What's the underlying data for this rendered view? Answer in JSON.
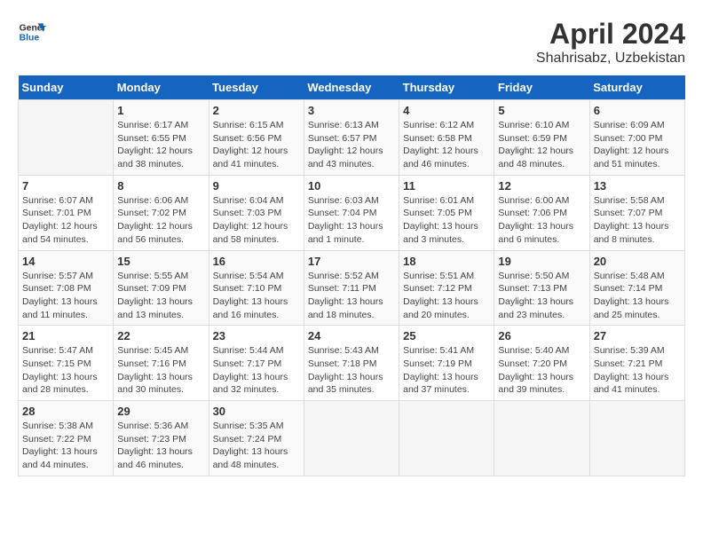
{
  "header": {
    "logo_line1": "General",
    "logo_line2": "Blue",
    "title": "April 2024",
    "subtitle": "Shahrisabz, Uzbekistan"
  },
  "calendar": {
    "days_of_week": [
      "Sunday",
      "Monday",
      "Tuesday",
      "Wednesday",
      "Thursday",
      "Friday",
      "Saturday"
    ],
    "weeks": [
      [
        {
          "num": "",
          "detail": ""
        },
        {
          "num": "1",
          "detail": "Sunrise: 6:17 AM\nSunset: 6:55 PM\nDaylight: 12 hours\nand 38 minutes."
        },
        {
          "num": "2",
          "detail": "Sunrise: 6:15 AM\nSunset: 6:56 PM\nDaylight: 12 hours\nand 41 minutes."
        },
        {
          "num": "3",
          "detail": "Sunrise: 6:13 AM\nSunset: 6:57 PM\nDaylight: 12 hours\nand 43 minutes."
        },
        {
          "num": "4",
          "detail": "Sunrise: 6:12 AM\nSunset: 6:58 PM\nDaylight: 12 hours\nand 46 minutes."
        },
        {
          "num": "5",
          "detail": "Sunrise: 6:10 AM\nSunset: 6:59 PM\nDaylight: 12 hours\nand 48 minutes."
        },
        {
          "num": "6",
          "detail": "Sunrise: 6:09 AM\nSunset: 7:00 PM\nDaylight: 12 hours\nand 51 minutes."
        }
      ],
      [
        {
          "num": "7",
          "detail": "Sunrise: 6:07 AM\nSunset: 7:01 PM\nDaylight: 12 hours\nand 54 minutes."
        },
        {
          "num": "8",
          "detail": "Sunrise: 6:06 AM\nSunset: 7:02 PM\nDaylight: 12 hours\nand 56 minutes."
        },
        {
          "num": "9",
          "detail": "Sunrise: 6:04 AM\nSunset: 7:03 PM\nDaylight: 12 hours\nand 58 minutes."
        },
        {
          "num": "10",
          "detail": "Sunrise: 6:03 AM\nSunset: 7:04 PM\nDaylight: 13 hours\nand 1 minute."
        },
        {
          "num": "11",
          "detail": "Sunrise: 6:01 AM\nSunset: 7:05 PM\nDaylight: 13 hours\nand 3 minutes."
        },
        {
          "num": "12",
          "detail": "Sunrise: 6:00 AM\nSunset: 7:06 PM\nDaylight: 13 hours\nand 6 minutes."
        },
        {
          "num": "13",
          "detail": "Sunrise: 5:58 AM\nSunset: 7:07 PM\nDaylight: 13 hours\nand 8 minutes."
        }
      ],
      [
        {
          "num": "14",
          "detail": "Sunrise: 5:57 AM\nSunset: 7:08 PM\nDaylight: 13 hours\nand 11 minutes."
        },
        {
          "num": "15",
          "detail": "Sunrise: 5:55 AM\nSunset: 7:09 PM\nDaylight: 13 hours\nand 13 minutes."
        },
        {
          "num": "16",
          "detail": "Sunrise: 5:54 AM\nSunset: 7:10 PM\nDaylight: 13 hours\nand 16 minutes."
        },
        {
          "num": "17",
          "detail": "Sunrise: 5:52 AM\nSunset: 7:11 PM\nDaylight: 13 hours\nand 18 minutes."
        },
        {
          "num": "18",
          "detail": "Sunrise: 5:51 AM\nSunset: 7:12 PM\nDaylight: 13 hours\nand 20 minutes."
        },
        {
          "num": "19",
          "detail": "Sunrise: 5:50 AM\nSunset: 7:13 PM\nDaylight: 13 hours\nand 23 minutes."
        },
        {
          "num": "20",
          "detail": "Sunrise: 5:48 AM\nSunset: 7:14 PM\nDaylight: 13 hours\nand 25 minutes."
        }
      ],
      [
        {
          "num": "21",
          "detail": "Sunrise: 5:47 AM\nSunset: 7:15 PM\nDaylight: 13 hours\nand 28 minutes."
        },
        {
          "num": "22",
          "detail": "Sunrise: 5:45 AM\nSunset: 7:16 PM\nDaylight: 13 hours\nand 30 minutes."
        },
        {
          "num": "23",
          "detail": "Sunrise: 5:44 AM\nSunset: 7:17 PM\nDaylight: 13 hours\nand 32 minutes."
        },
        {
          "num": "24",
          "detail": "Sunrise: 5:43 AM\nSunset: 7:18 PM\nDaylight: 13 hours\nand 35 minutes."
        },
        {
          "num": "25",
          "detail": "Sunrise: 5:41 AM\nSunset: 7:19 PM\nDaylight: 13 hours\nand 37 minutes."
        },
        {
          "num": "26",
          "detail": "Sunrise: 5:40 AM\nSunset: 7:20 PM\nDaylight: 13 hours\nand 39 minutes."
        },
        {
          "num": "27",
          "detail": "Sunrise: 5:39 AM\nSunset: 7:21 PM\nDaylight: 13 hours\nand 41 minutes."
        }
      ],
      [
        {
          "num": "28",
          "detail": "Sunrise: 5:38 AM\nSunset: 7:22 PM\nDaylight: 13 hours\nand 44 minutes."
        },
        {
          "num": "29",
          "detail": "Sunrise: 5:36 AM\nSunset: 7:23 PM\nDaylight: 13 hours\nand 46 minutes."
        },
        {
          "num": "30",
          "detail": "Sunrise: 5:35 AM\nSunset: 7:24 PM\nDaylight: 13 hours\nand 48 minutes."
        },
        {
          "num": "",
          "detail": ""
        },
        {
          "num": "",
          "detail": ""
        },
        {
          "num": "",
          "detail": ""
        },
        {
          "num": "",
          "detail": ""
        }
      ]
    ]
  }
}
